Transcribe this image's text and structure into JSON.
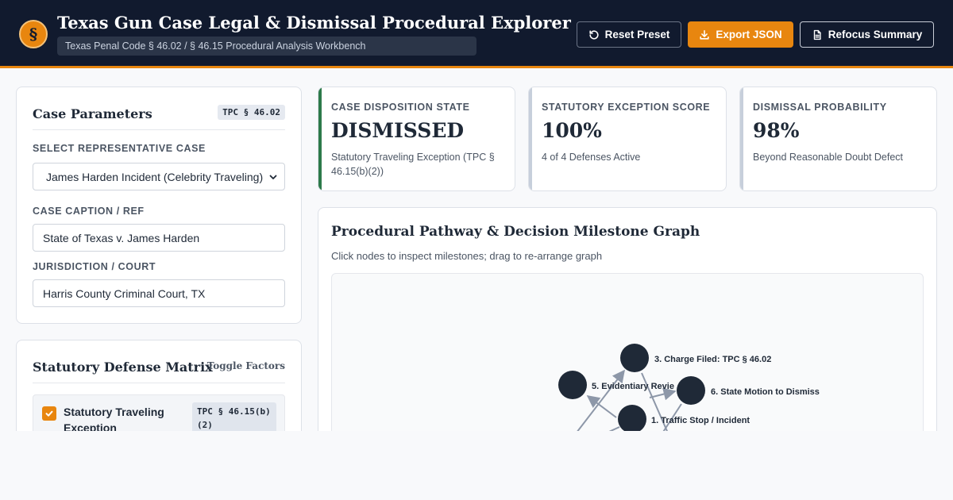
{
  "header": {
    "logo_glyph": "§",
    "title": "Texas Gun Case Legal & Dismissal Procedural Explorer",
    "subtitle": "Texas Penal Code § 46.02 / § 46.15 Procedural Analysis Workbench",
    "buttons": {
      "reset": "Reset Preset",
      "export": "Export JSON",
      "refocus": "Refocus Summary"
    },
    "colors": {
      "background": "#111a2e",
      "accent": "#e8860f"
    }
  },
  "params": {
    "title": "Case Parameters",
    "tag": "TPC § 46.02",
    "case_label": "SELECT REPRESENTATIVE CASE",
    "case_value": "James Harden Incident (Celebrity Traveling)",
    "caption_label": "CASE CAPTION / REF",
    "caption_value": "State of Texas v. James Harden",
    "jurisdiction_label": "JURISDICTION / COURT",
    "jurisdiction_value": "Harris County Criminal Court, TX"
  },
  "matrix": {
    "title": "Statutory Defense Matrix",
    "toggle_label": "Toggle Factors",
    "items": [
      {
        "name": "Statutory Traveling Exception",
        "tag": "TPC § 46.15(b)(2)",
        "checked": true
      }
    ]
  },
  "metrics": [
    {
      "label": "CASE DISPOSITION STATE",
      "value": "DISMISSED",
      "sub": "Statutory Traveling Exception (TPC § 46.15(b)(2))",
      "accent": "#2d7a4a"
    },
    {
      "label": "STATUTORY EXCEPTION SCORE",
      "value": "100%",
      "sub": "4 of 4 Defenses Active"
    },
    {
      "label": "DISMISSAL PROBABILITY",
      "value": "98%",
      "sub": "Beyond Reasonable Doubt Defect"
    }
  ],
  "graph": {
    "title": "Procedural Pathway & Decision Milestone Graph",
    "subtitle": "Click nodes to inspect milestones; drag to re-arrange graph",
    "nodes": [
      {
        "id": "n3",
        "label": "3. Charge Filed: TPC § 46.02"
      },
      {
        "id": "n5",
        "label": "5. Evidentiary Revie"
      },
      {
        "id": "n6",
        "label": "6. State Motion to Dismiss"
      },
      {
        "id": "n1",
        "label": "1. Traffic Stop / Incident"
      }
    ],
    "colors": {
      "node": "#1f2937",
      "edge": "#8d97a8"
    }
  }
}
